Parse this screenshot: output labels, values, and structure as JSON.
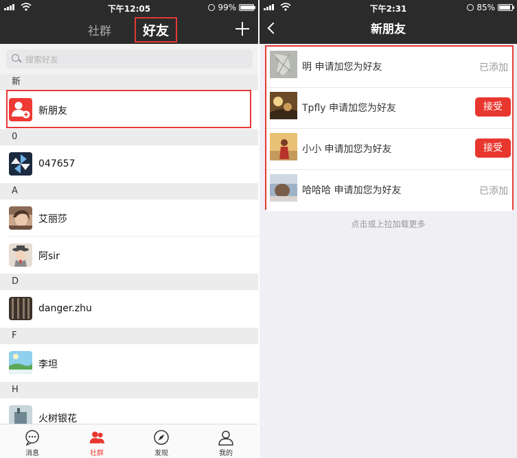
{
  "left": {
    "status": {
      "time": "下午12:05",
      "battery_text": "99%",
      "battery_level": 0.99
    },
    "nav": {
      "tab_groups": "社群",
      "tab_friends": "好友"
    },
    "search": {
      "placeholder": "搜索好友"
    },
    "sections": [
      {
        "letter": "新",
        "items": [
          {
            "name": "新朋友"
          }
        ]
      },
      {
        "letter": "0",
        "items": [
          {
            "name": "047657"
          }
        ]
      },
      {
        "letter": "A",
        "items": [
          {
            "name": "艾丽莎"
          },
          {
            "name": "阿sir"
          }
        ]
      },
      {
        "letter": "D",
        "items": [
          {
            "name": "danger.zhu"
          }
        ]
      },
      {
        "letter": "F",
        "items": [
          {
            "name": "李坦"
          }
        ]
      },
      {
        "letter": "H",
        "items": [
          {
            "name": "火树银花"
          }
        ]
      }
    ],
    "tabbar": {
      "messages": "消息",
      "community": "社群",
      "discover": "发现",
      "mine": "我的"
    }
  },
  "right": {
    "status": {
      "time": "下午2:31",
      "battery_text": "85%",
      "battery_level": 0.85
    },
    "nav": {
      "title": "新朋友"
    },
    "requests": [
      {
        "text": "明 申请加您为好友",
        "action": "已添加",
        "state": "added"
      },
      {
        "text": "Tpfly 申请加您为好友",
        "action": "接受",
        "state": "accept"
      },
      {
        "text": "小小 申请加您为好友",
        "action": "接受",
        "state": "accept"
      },
      {
        "text": "哈哈哈 申请加您为好友",
        "action": "已添加",
        "state": "added"
      }
    ],
    "load_more": "点击或上拉加载更多"
  },
  "colors": {
    "accent": "#e8372f",
    "navbar": "#2b2b2b",
    "highlight": "#e53935"
  }
}
